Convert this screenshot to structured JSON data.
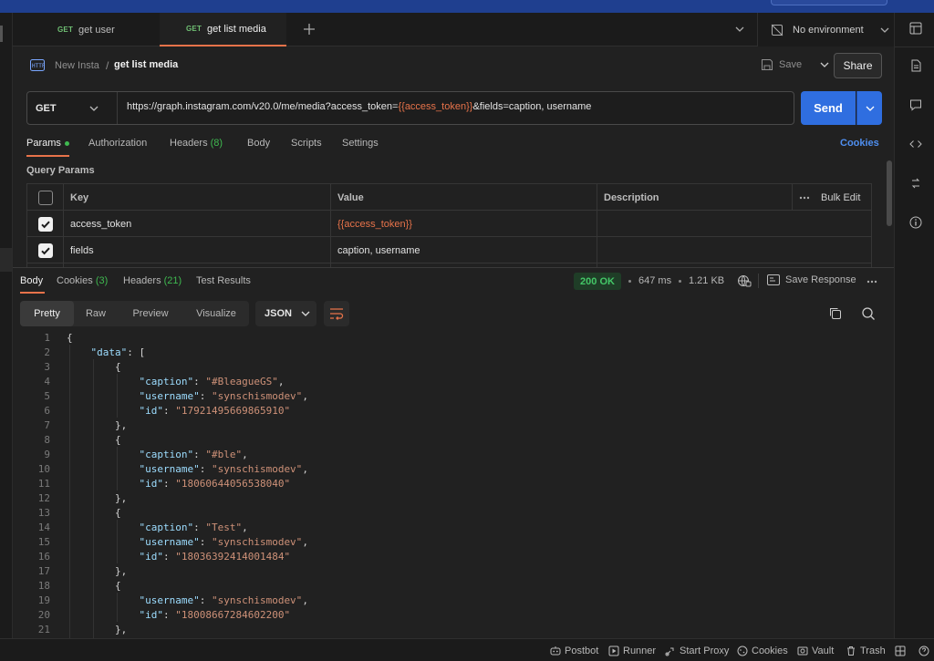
{
  "tabs": [
    {
      "method": "GET",
      "label": "get user"
    },
    {
      "method": "GET",
      "label": "get list media"
    }
  ],
  "environment": {
    "label": "No environment"
  },
  "breadcrumb": {
    "collection": "New Insta",
    "separator": "/",
    "request": "get list media"
  },
  "toolbar": {
    "save_label": "Save",
    "share_label": "Share"
  },
  "request": {
    "method": "GET",
    "url_prefix": "https://graph.instagram.com/v20.0/me/media?access_token=",
    "url_var": "{{access_token}}",
    "url_suffix": "&fields=caption, username",
    "send_label": "Send"
  },
  "request_tabs": {
    "params": "Params",
    "authorization": "Authorization",
    "headers": "Headers",
    "headers_count": "(8)",
    "body": "Body",
    "scripts": "Scripts",
    "settings": "Settings",
    "cookies": "Cookies"
  },
  "query_params": {
    "title": "Query Params",
    "columns": {
      "key": "Key",
      "value": "Value",
      "description": "Description",
      "bulk_edit": "Bulk Edit"
    },
    "rows": [
      {
        "key": "access_token",
        "value": "{{access_token}}",
        "checked": true
      },
      {
        "key": "fields",
        "value": "caption, username",
        "checked": true
      }
    ]
  },
  "response_tabs": {
    "body": "Body",
    "cookies": "Cookies",
    "cookies_count": "(3)",
    "headers": "Headers",
    "headers_count": "(21)",
    "tests": "Test Results"
  },
  "response_meta": {
    "status": "200 OK",
    "time": "647 ms",
    "size": "1.21 KB",
    "save_response": "Save Response"
  },
  "views": {
    "pretty": "Pretty",
    "raw": "Raw",
    "preview": "Preview",
    "visualize": "Visualize",
    "format": "JSON"
  },
  "code_lines": [
    "{",
    "    \"data\": [",
    "        {",
    "            \"caption\": \"#BleagueGS\",",
    "            \"username\": \"synschismodev\",",
    "            \"id\": \"17921495669865910\"",
    "        },",
    "        {",
    "            \"caption\": \"#ble\",",
    "            \"username\": \"synschismodev\",",
    "            \"id\": \"18060644056538040\"",
    "        },",
    "        {",
    "            \"caption\": \"Test\",",
    "            \"username\": \"synschismodev\",",
    "            \"id\": \"18036392414001484\"",
    "        },",
    "        {",
    "            \"username\": \"synschismodev\",",
    "            \"id\": \"18008667284602200\"",
    "        },"
  ],
  "footer": {
    "postbot": "Postbot",
    "runner": "Runner",
    "start_proxy": "Start Proxy",
    "cookies": "Cookies",
    "vault": "Vault",
    "trash": "Trash"
  },
  "colors": {
    "accent": "#e8734a",
    "send": "#2f6ee0",
    "ok": "#44c767",
    "link": "#4f8ff0"
  }
}
